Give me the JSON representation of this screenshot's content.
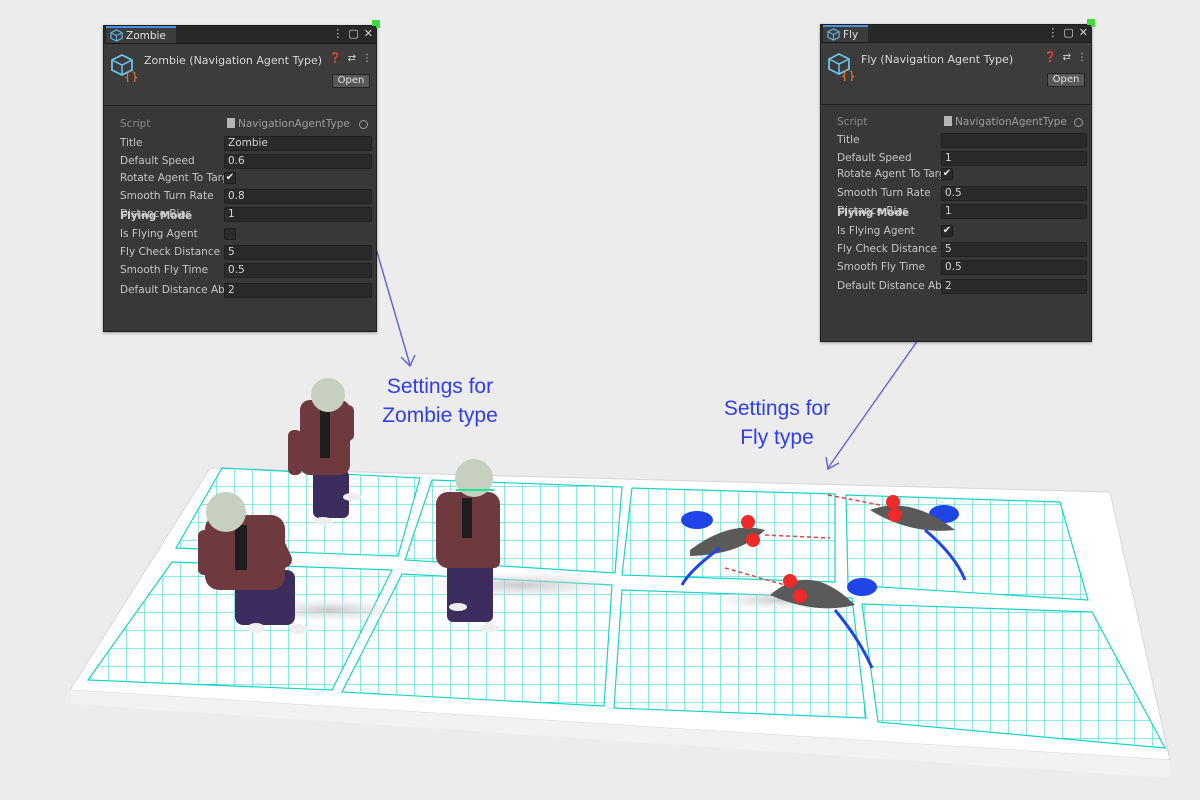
{
  "zombie_panel": {
    "tab_label": "Zombie",
    "header_title": "Zombie (Navigation Agent Type)",
    "open_button": "Open",
    "script_label": "Script",
    "script_value": "NavigationAgentType",
    "title_label": "Title",
    "title_value": "Zombie",
    "default_speed_label": "Default Speed",
    "default_speed_value": "0.6",
    "rotate_label": "Rotate Agent To Targ",
    "rotate_checked": "✔",
    "smooth_turn_label": "Smooth Turn Rate",
    "smooth_turn_value": "0.8",
    "distance_bias_label": "Distance Bias",
    "distance_bias_value": "1",
    "flying_mode_heading": "Flying Mode",
    "is_flying_label": "Is Flying Agent",
    "is_flying_checked": "",
    "fly_check_label": "Fly Check Distance",
    "fly_check_value": "5",
    "smooth_fly_label": "Smooth Fly Time",
    "smooth_fly_value": "0.5",
    "default_distance_label": "Default Distance Abo",
    "default_distance_value": "2"
  },
  "fly_panel": {
    "tab_label": "Fly",
    "header_title": "Fly (Navigation Agent Type)",
    "open_button": "Open",
    "script_label": "Script",
    "script_value": "NavigationAgentType",
    "title_label": "Title",
    "title_value": "",
    "default_speed_label": "Default Speed",
    "default_speed_value": "1",
    "rotate_label": "Rotate Agent To Targ",
    "rotate_checked": "✔",
    "smooth_turn_label": "Smooth Turn Rate",
    "smooth_turn_value": "0.5",
    "distance_bias_label": "Distance Bias",
    "distance_bias_value": "1",
    "flying_mode_heading": "Flying Mode",
    "is_flying_label": "Is Flying Agent",
    "is_flying_checked": "✔",
    "fly_check_label": "Fly Check Distance",
    "fly_check_value": "5",
    "smooth_fly_label": "Smooth Fly Time",
    "smooth_fly_value": "0.5",
    "default_distance_label": "Default Distance Abo",
    "default_distance_value": "2"
  },
  "callouts": {
    "zombie_line1": "Settings for",
    "zombie_line2": "Zombie type",
    "fly_line1": "Settings for",
    "fly_line2": "Fly type"
  },
  "icons": {
    "tab": "prefab-cube-icon",
    "header": "scriptable-object-icon",
    "menu": "kebab-menu-icon",
    "maximize": "maximize-icon",
    "close": "close-icon",
    "help": "help-icon",
    "presets": "presets-icon",
    "object_picker": "object-picker-icon"
  },
  "colors": {
    "navmesh_grid": "#19d3c5",
    "callout_text": "#2f3ee8",
    "inspector_bg": "#383838",
    "accent_tab": "#4a90e2"
  }
}
